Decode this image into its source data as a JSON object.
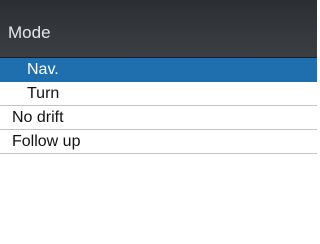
{
  "dialog": {
    "title": "Mode"
  },
  "menu": {
    "items": [
      {
        "label": "Nav.",
        "selected": true
      },
      {
        "label": "Turn",
        "selected": false
      },
      {
        "label": "No drift",
        "selected": false
      },
      {
        "label": "Follow up",
        "selected": false
      }
    ]
  },
  "colors": {
    "title_bar": "#35393d",
    "title_text": "#e6e8ea",
    "selection": "#1f6fae",
    "divider": "#d9b7bf"
  }
}
